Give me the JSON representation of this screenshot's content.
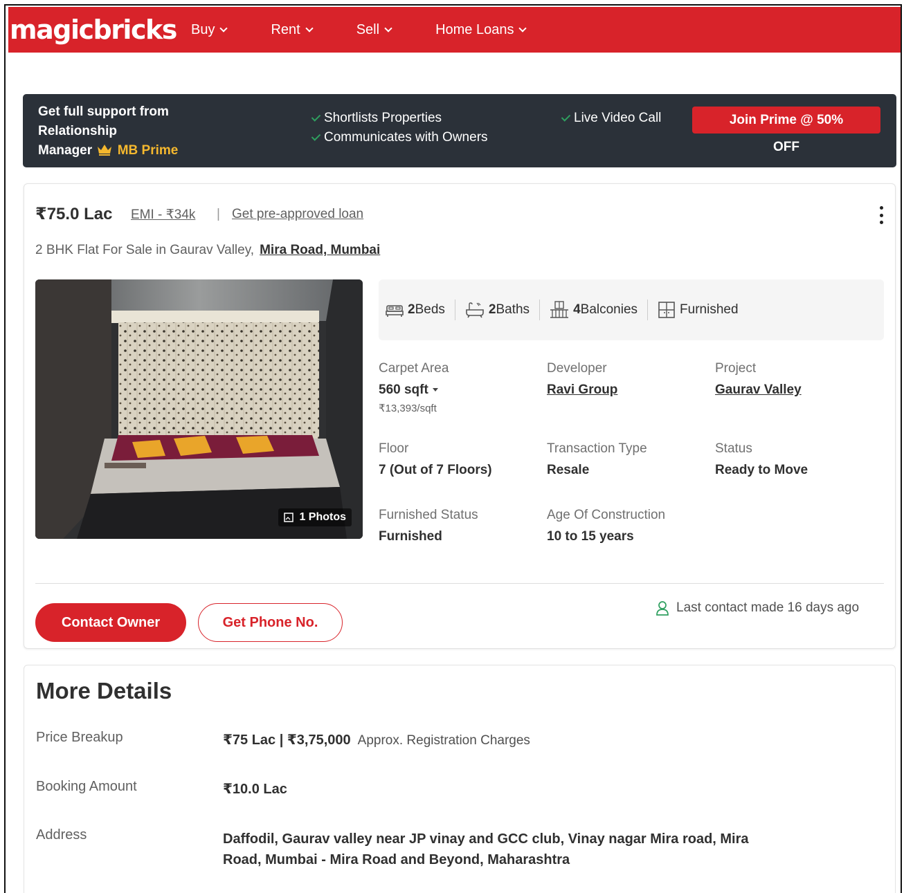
{
  "header": {
    "logo": "magicbricks",
    "nav": [
      {
        "label": "Buy"
      },
      {
        "label": "Rent"
      },
      {
        "label": "Sell"
      },
      {
        "label": "Home Loans"
      }
    ]
  },
  "prime_banner": {
    "title_line1": "Get full support from",
    "title_line2": "Relationship",
    "title_line3": "Manager",
    "brand": "MB Prime",
    "features": [
      "Shortlists Properties",
      "Communicates with Owners",
      "Live Video Call"
    ],
    "cta": "Join Prime @ 50%",
    "cta_sub": "OFF"
  },
  "listing": {
    "price": "₹75.0 Lac",
    "emi": "EMI - ₹34k",
    "separator": "|",
    "loan_link": "Get pre-approved loan",
    "subtitle": "2 BHK Flat For Sale in Gaurav Valley,",
    "location": "Mira Road, Mumbai",
    "photos_badge": "1 Photos",
    "amenities": [
      {
        "count": "2",
        "label": "Beds",
        "icon": "bed-icon"
      },
      {
        "count": "2",
        "label": "Baths",
        "icon": "bathtub-icon"
      },
      {
        "count": "4",
        "label": "Balconies",
        "icon": "balcony-icon"
      },
      {
        "count": "",
        "label": "Furnished",
        "icon": "furnished-icon"
      }
    ],
    "details": {
      "carpet_area_label": "Carpet Area",
      "carpet_area": "560 sqft",
      "price_per_sqft": "₹13,393/sqft",
      "developer_label": "Developer",
      "developer": "Ravi Group",
      "project_label": "Project",
      "project": "Gaurav Valley",
      "floor_label": "Floor",
      "floor": "7 (Out of 7 Floors)",
      "transaction_label": "Transaction Type",
      "transaction": "Resale",
      "status_label": "Status",
      "status": "Ready to Move",
      "furnished_label": "Furnished Status",
      "furnished": "Furnished",
      "age_label": "Age Of Construction",
      "age": "10 to 15 years"
    },
    "contact_button": "Contact Owner",
    "phone_button": "Get Phone No.",
    "last_contact": "Last contact made 16 days ago"
  },
  "more_details": {
    "title": "More Details",
    "price_breakup_label": "Price Breakup",
    "price_breakup": "₹75 Lac | ₹3,75,000",
    "price_breakup_note": "Approx. Registration Charges",
    "booking_label": "Booking Amount",
    "booking": "₹10.0 Lac",
    "address_label": "Address",
    "address_line1": "Daffodil, Gaurav valley near JP vinay and GCC club, Vinay nagar Mira road, Mira",
    "address_line2": "Road, Mumbai - Mira Road and Beyond, Maharashtra"
  },
  "colors": {
    "brand_red": "#d8232a",
    "prime_dark": "#2b3139",
    "prime_gold": "#f5b82e",
    "tick_green": "#2e9f5f"
  }
}
